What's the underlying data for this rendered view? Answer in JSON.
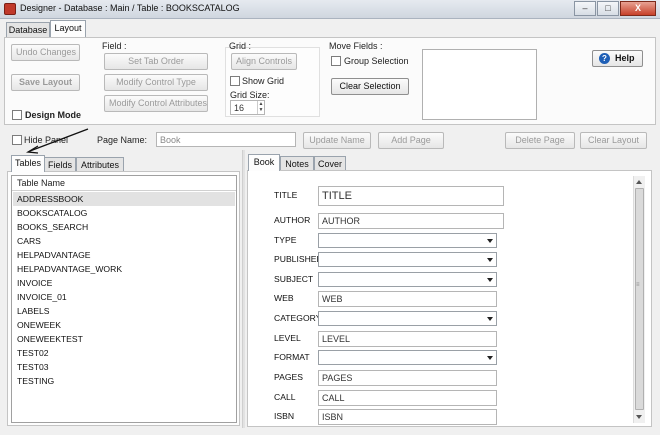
{
  "window": {
    "title": "Designer - Database : Main / Table : BOOKSCATALOG",
    "min_icon": "minimize-icon",
    "max_icon": "maximize-icon",
    "close_label": "X"
  },
  "main_tabs": [
    "Database",
    "Layout"
  ],
  "toolbar": {
    "undo_changes": "Undo Changes",
    "save_layout": "Save Layout",
    "design_mode": "Design Mode",
    "field_label": "Field :",
    "set_tab_order": "Set Tab Order",
    "modify_control_type": "Modify Control Type",
    "modify_control_attributes": "Modify Control Attributes",
    "grid_label": "Grid :",
    "align_controls": "Align Controls",
    "show_grid": "Show Grid",
    "grid_size_label": "Grid Size:",
    "grid_size_value": "16",
    "move_fields_label": "Move Fields :",
    "group_selection": "Group Selection",
    "clear_selection": "Clear Selection",
    "help_label": "Help",
    "help_glyph": "?"
  },
  "page_bar": {
    "hide_panel": "Hide Panel",
    "page_name_label": "Page Name:",
    "page_name_value": "Book",
    "update_name": "Update Name",
    "add_page": "Add Page",
    "delete_page": "Delete Page",
    "clear_layout": "Clear Layout"
  },
  "left_tabs": [
    "Tables",
    "Fields",
    "Attributes"
  ],
  "tables_list": {
    "header": "Table Name",
    "rows": [
      "ADDRESSBOOK",
      "BOOKSCATALOG",
      "BOOKS_SEARCH",
      "CARS",
      "HELPADVANTAGE",
      "HELPADVANTAGE_WORK",
      "INVOICE",
      "INVOICE_01",
      "LABELS",
      "ONEWEEK",
      "ONEWEEKTEST",
      "TEST02",
      "TEST03",
      "TESTING"
    ]
  },
  "right_tabs": [
    "Book",
    "Notes",
    "Cover"
  ],
  "form": {
    "fields": [
      {
        "label": "TITLE",
        "type": "text",
        "value": "TITLE"
      },
      {
        "label": "AUTHOR",
        "type": "text",
        "value": "AUTHOR"
      },
      {
        "label": "TYPE",
        "type": "select",
        "value": ""
      },
      {
        "label": "PUBLISHED",
        "type": "select",
        "value": ""
      },
      {
        "label": "SUBJECT",
        "type": "select",
        "value": ""
      },
      {
        "label": "WEB",
        "type": "text",
        "value": "WEB"
      },
      {
        "label": "CATEGORY",
        "type": "select",
        "value": ""
      },
      {
        "label": "LEVEL",
        "type": "text",
        "value": "LEVEL"
      },
      {
        "label": "FORMAT",
        "type": "select",
        "value": ""
      },
      {
        "label": "PAGES",
        "type": "text",
        "value": "PAGES"
      },
      {
        "label": "CALL",
        "type": "text",
        "value": "CALL"
      },
      {
        "label": "ISBN",
        "type": "text",
        "value": "ISBN"
      }
    ]
  }
}
